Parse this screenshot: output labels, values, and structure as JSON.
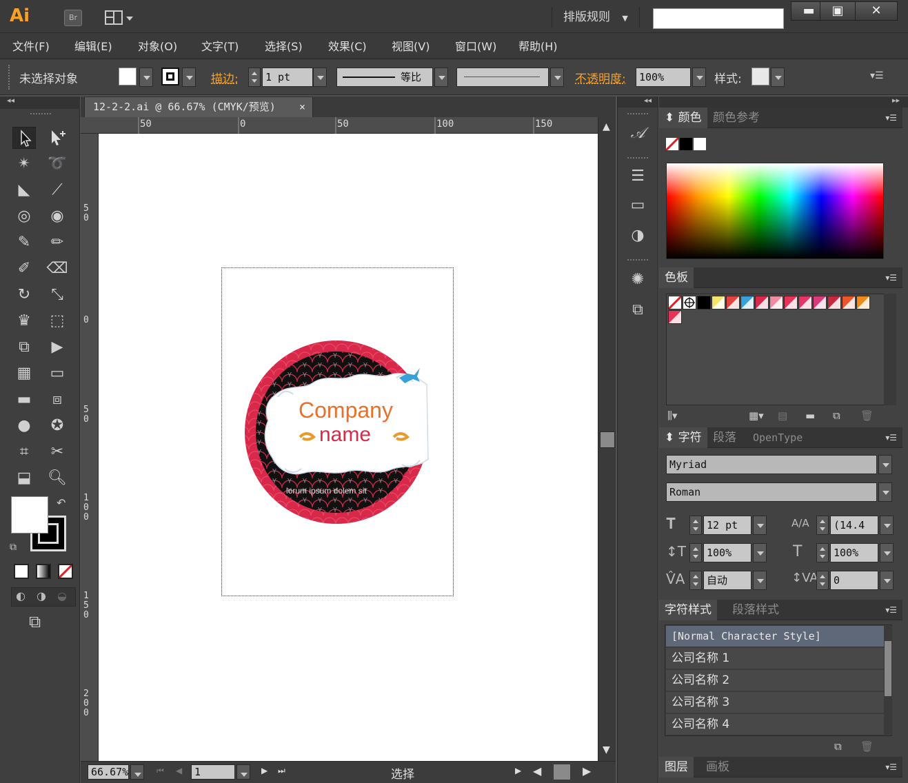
{
  "app": {
    "logo": "Ai",
    "bridge_label": "Br",
    "workspace": "排版规则",
    "search_value": ""
  },
  "menu": [
    "文件(F)",
    "编辑(E)",
    "对象(O)",
    "文字(T)",
    "选择(S)",
    "效果(C)",
    "视图(V)",
    "窗口(W)",
    "帮助(H)"
  ],
  "control": {
    "selection_status": "未选择对象",
    "stroke_label": "描边:",
    "stroke_weight": "1 pt",
    "stroke_profile": "等比",
    "opacity_label": "不透明度:",
    "opacity_value": "100%",
    "style_label": "样式:"
  },
  "document": {
    "tab_title": "12-2-2.ai @ 66.67% (CMYK/预览)",
    "close_glyph": "×",
    "ruler_top": [
      "50",
      "0",
      "50",
      "100",
      "150"
    ],
    "ruler_left": [
      "5\n0",
      "0",
      "5\n0",
      "1\n0\n0",
      "1\n5\n0",
      "2\n0\n0"
    ]
  },
  "artwork": {
    "line1": "Company",
    "line2": "name",
    "tagline": "lorum ipsum dolem sit",
    "colors": {
      "red": "#d9294a",
      "orange": "#e8702a",
      "amber": "#e89a2a",
      "bird": "#3aa0d8",
      "black": "#111111"
    }
  },
  "status": {
    "zoom": "66.67%",
    "artboard": "1",
    "tool": "选择"
  },
  "color_panel": {
    "tabs": [
      "颜色",
      "颜色参考"
    ]
  },
  "swatches_panel": {
    "title": "色板",
    "swatches": [
      "#ffffff",
      "#ffffff",
      "#000000",
      "#f3e56a",
      "#e0443c",
      "#3aa0d8",
      "#d9294a",
      "#f08aa0",
      "#e63458",
      "#e63466",
      "#d93a7a",
      "#c8283e",
      "#e8562a",
      "#f08a1a",
      "#e63458"
    ]
  },
  "character_panel": {
    "tabs": [
      "字符",
      "段落",
      "OpenType"
    ],
    "font_family": "Myriad",
    "font_style": "Roman",
    "font_size": "12 pt",
    "leading": "(14.4",
    "vertical_scale": "100%",
    "horizontal_scale": "100%",
    "kerning": "自动",
    "tracking": "0"
  },
  "char_styles_panel": {
    "tabs": [
      "字符样式",
      "段落样式"
    ],
    "styles": [
      "[Normal Character Style]",
      "公司名称 1",
      "公司名称 2",
      "公司名称 3",
      "公司名称 4"
    ]
  },
  "layers_panel": {
    "tabs": [
      "图层",
      "画板"
    ]
  }
}
